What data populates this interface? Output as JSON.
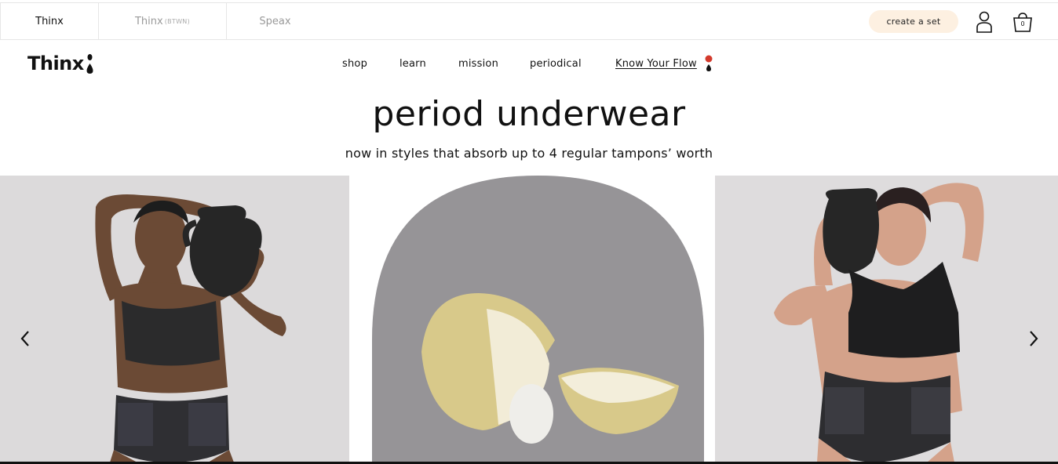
{
  "brands": [
    {
      "name": "Thinx",
      "sub": ""
    },
    {
      "name": "Thinx",
      "sub": "(BTWN)"
    },
    {
      "name": "Speax",
      "sub": ""
    }
  ],
  "header": {
    "create_set": "create a set",
    "cart_count": "0"
  },
  "logo": {
    "text": "Thinx"
  },
  "nav": {
    "shop": "shop",
    "learn": "learn",
    "mission": "mission",
    "periodical": "periodical",
    "know_your_flow": "Know Your Flow"
  },
  "hero": {
    "title": "period underwear",
    "subtitle": "now in styles that absorb up to 4 regular tampons’ worth"
  },
  "icons": {
    "account": "user-icon",
    "cart": "shopping-bag-icon",
    "prev": "chevron-left-icon",
    "next": "chevron-right-icon"
  },
  "colors": {
    "accent_peach": "#fdf0e1",
    "kyf_red": "#d33a2c",
    "text": "#111111"
  }
}
